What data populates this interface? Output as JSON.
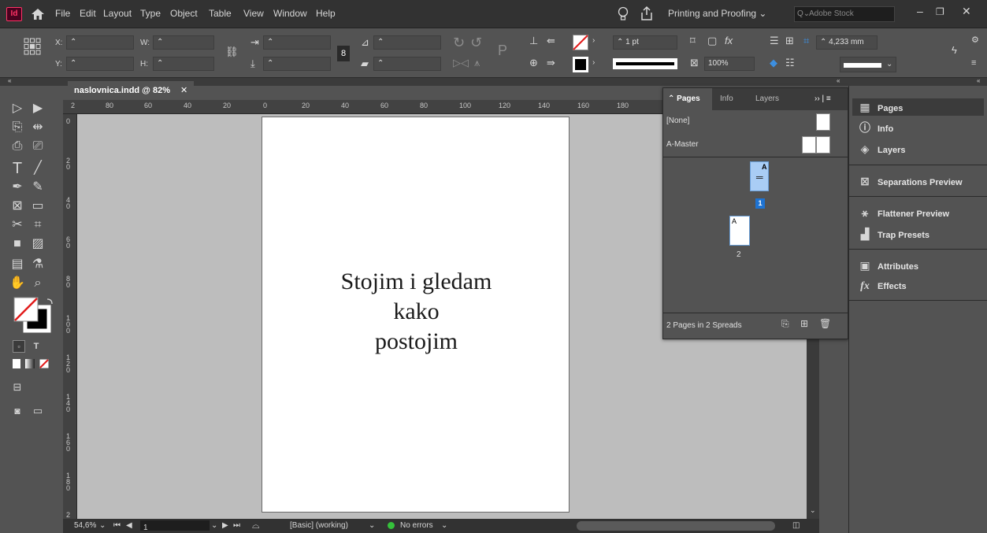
{
  "menu": {
    "app_logo": "Id",
    "items": [
      "File",
      "Edit",
      "Layout",
      "Type",
      "Object",
      "Table",
      "View",
      "Window",
      "Help"
    ],
    "workspace": "Printing and Proofing",
    "stock_placeholder": "Adobe Stock"
  },
  "control": {
    "x_label": "X:",
    "y_label": "Y:",
    "w_label": "W:",
    "h_label": "H:",
    "stroke_weight": "1 pt",
    "scale": "100%",
    "offset": "4,233 mm"
  },
  "document": {
    "tab_title": "naslovnica.indd @ 82%",
    "page_text": [
      "Stojim i gledam",
      "kako",
      "postojim"
    ],
    "ruler_h": [
      "80",
      "60",
      "40",
      "20",
      "0",
      "20",
      "40",
      "60",
      "80",
      "100",
      "120",
      "140",
      "160",
      "180",
      "2"
    ],
    "ruler_v": [
      "0",
      "2",
      "4",
      "6",
      "8",
      "1",
      "0",
      "1",
      "2",
      "1",
      "4",
      "1",
      "6",
      "1",
      "8",
      "2"
    ]
  },
  "status": {
    "zoom": "54,6%",
    "page": "1",
    "profile": "[Basic] (working)",
    "errors": "No errors"
  },
  "pages_panel": {
    "tabs": [
      "Pages",
      "Info",
      "Layers"
    ],
    "masters": [
      "[None]",
      "A-Master"
    ],
    "page1_label": "1",
    "page2_label": "2",
    "page_master_prefix": "A",
    "footer": "2 Pages in 2 Spreads"
  },
  "dock": {
    "items": [
      "Pages",
      "Info",
      "Layers",
      "Separations Preview",
      "Flattener Preview",
      "Trap Presets",
      "Attributes",
      "Effects"
    ]
  }
}
